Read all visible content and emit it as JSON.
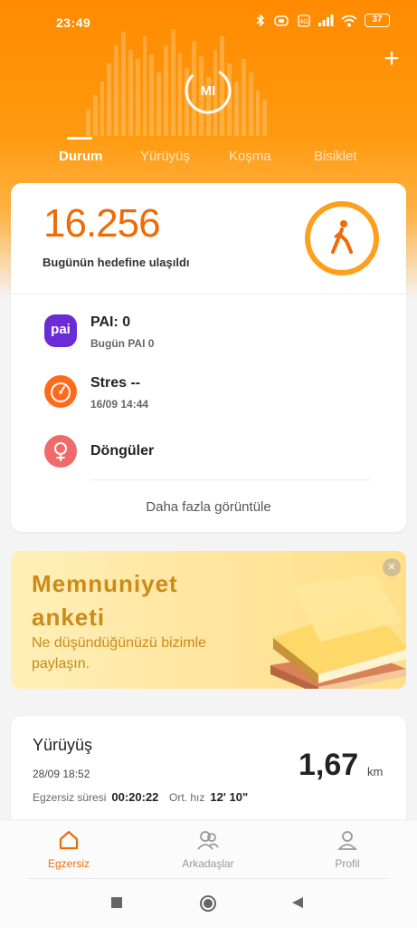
{
  "status_bar": {
    "time": "23:49",
    "signal": "4G",
    "battery": "37",
    "icons": [
      "bluetooth-icon",
      "vibrate-icon",
      "hd-icon",
      "signal-icon",
      "wifi-icon",
      "battery-icon"
    ]
  },
  "header": {
    "add_label": "+",
    "logo_text": "MI",
    "tabs": [
      {
        "label": "Durum",
        "active": true
      },
      {
        "label": "Yürüyüş",
        "active": false
      },
      {
        "label": "Koşma",
        "active": false
      },
      {
        "label": "Bisiklet",
        "active": false
      }
    ]
  },
  "steps_card": {
    "steps": "16.256",
    "goal_text": "Bugünün hedefine ulaşıldı",
    "metrics": [
      {
        "icon": "pai-icon",
        "icon_text": "pai",
        "title": "PAI: 0",
        "subtitle": "Bugün PAI 0"
      },
      {
        "icon": "stress-gauge-icon",
        "title": "Stres --",
        "subtitle": "16/09 14:44"
      },
      {
        "icon": "cycle-icon",
        "title": "Döngüler",
        "subtitle": ""
      }
    ],
    "more_label": "Daha fazla görüntüle"
  },
  "banner": {
    "title_line1": "Memnuniyet",
    "title_line2": "anketi",
    "subtitle_line1": "Ne düşündüğünüzü bizimle",
    "subtitle_line2": "paylaşın.",
    "close": "×"
  },
  "workout": {
    "title": "Yürüyüş",
    "date": "28/09 18:52",
    "value": "1,67",
    "unit": "km",
    "duration_label": "Egzersiz süresi",
    "duration_value": "00:20:22",
    "pace_label": "Ort. hız",
    "pace_value": "12' 10\""
  },
  "bottom_nav": [
    {
      "label": "Egzersiz",
      "active": true
    },
    {
      "label": "Arkadaşlar",
      "active": false
    },
    {
      "label": "Profil",
      "active": false
    }
  ],
  "colors": {
    "accent": "#ee6b06",
    "header_orange": "#ff8a00",
    "ring": "#ff9f1c",
    "pai_purple": "#6b2bd6",
    "banner_text": "#cc8a18"
  }
}
